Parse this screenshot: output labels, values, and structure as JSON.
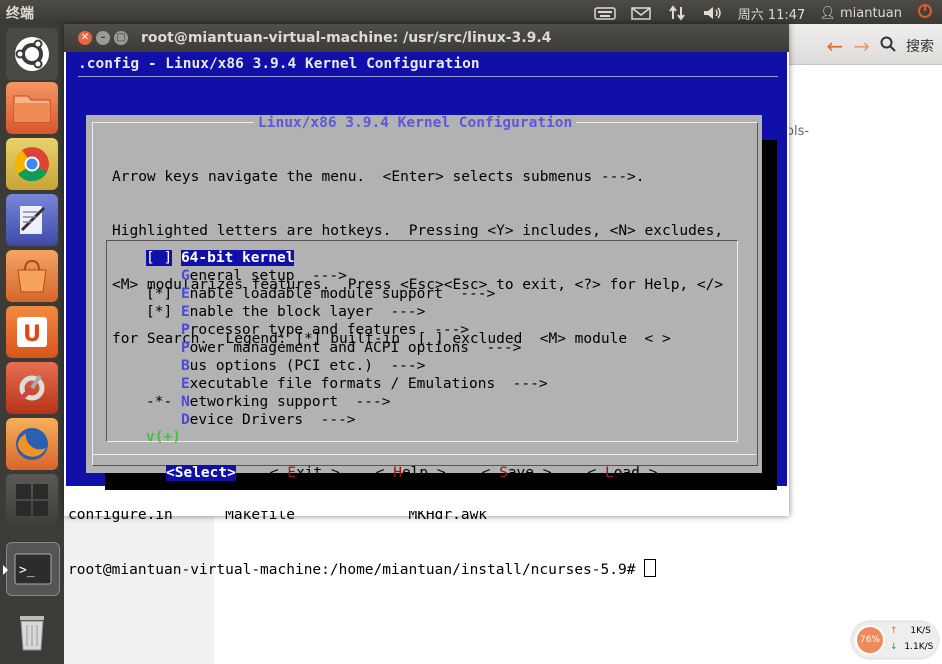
{
  "topbar": {
    "app_name": "终端",
    "icons": [
      "keyboard-icon",
      "mail-icon",
      "network-icon",
      "volume-icon"
    ],
    "clock": "周六 11:47",
    "user": "miantuan"
  },
  "launcher": {
    "items": [
      "ubuntu-logo",
      "files",
      "chrome",
      "text-editor",
      "software-center",
      "ubuntu-one",
      "system-settings",
      "firefox",
      "workspace-switcher",
      "terminal",
      "trash"
    ]
  },
  "background_window": {
    "search_label": "搜索",
    "partial_text": "ols-"
  },
  "terminal": {
    "title": "root@miantuan-virtual-machine: /usr/src/linux-3.9.4",
    "config_title": ".config - Linux/x86 3.9.4 Kernel Configuration",
    "dialog_title": "Linux/x86 3.9.4 Kernel Configuration",
    "help_lines": [
      "Arrow keys navigate the menu.  <Enter> selects submenus --->.",
      "Highlighted letters are hotkeys.  Pressing <Y> includes, <N> excludes,",
      "<M> modularizes features.  Press <Esc><Esc> to exit, <?> for Help, </>",
      "for Search.  Legend: [*] built-in  [ ] excluded  <M> module  < >"
    ],
    "menu_items": [
      {
        "prefix": "[ ]",
        "hotkey": "",
        "rest": "64-bit kernel",
        "selected": true
      },
      {
        "prefix": "   ",
        "hotkey": "G",
        "rest": "eneral setup  --->",
        "selected": false
      },
      {
        "prefix": "[*]",
        "hotkey": "E",
        "rest": "nable loadable module support  --->",
        "selected": false
      },
      {
        "prefix": "[*]",
        "hotkey": "E",
        "rest": "nable the block layer  --->",
        "selected": false
      },
      {
        "prefix": "   ",
        "hotkey": "P",
        "rest": "rocessor type and features  --->",
        "selected": false
      },
      {
        "prefix": "   ",
        "hotkey": "P",
        "rest": "ower management and ACPI options  --->",
        "selected": false
      },
      {
        "prefix": "   ",
        "hotkey": "B",
        "rest": "us options (PCI etc.)  --->",
        "selected": false
      },
      {
        "prefix": "   ",
        "hotkey": "E",
        "rest": "xecutable file formats / Emulations  --->",
        "selected": false
      },
      {
        "prefix": "-*-",
        "hotkey": "N",
        "rest": "etworking support  --->",
        "selected": false
      },
      {
        "prefix": "   ",
        "hotkey": "D",
        "rest": "evice Drivers  --->",
        "selected": false
      }
    ],
    "more_indicator": "v(+)",
    "buttons": [
      {
        "label": "Select",
        "hotkey": "",
        "rest": "",
        "selected": true
      },
      {
        "label": "",
        "hotkey": "E",
        "rest": "xit",
        "selected": false
      },
      {
        "label": "",
        "hotkey": "H",
        "rest": "elp",
        "selected": false
      },
      {
        "label": "",
        "hotkey": "S",
        "rest": "ave",
        "selected": false
      },
      {
        "label": "",
        "hotkey": "L",
        "rest": "oad",
        "selected": false
      }
    ],
    "shell_line1": "configure.in      Makefile             MKHdr.awk",
    "prompt": "root@miantuan-virtual-machine:/home/miantuan/install/ncurses-5.9# "
  },
  "netmon": {
    "percent": "76%",
    "up": "1K/S",
    "down": "1.1K/S"
  }
}
